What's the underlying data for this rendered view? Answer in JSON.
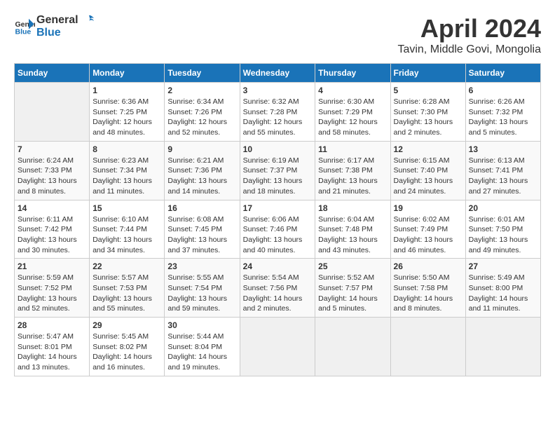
{
  "header": {
    "logo_general": "General",
    "logo_blue": "Blue",
    "month": "April 2024",
    "location": "Tavin, Middle Govi, Mongolia"
  },
  "weekdays": [
    "Sunday",
    "Monday",
    "Tuesday",
    "Wednesday",
    "Thursday",
    "Friday",
    "Saturday"
  ],
  "weeks": [
    [
      {
        "day": "",
        "sunrise": "",
        "sunset": "",
        "daylight": ""
      },
      {
        "day": "1",
        "sunrise": "Sunrise: 6:36 AM",
        "sunset": "Sunset: 7:25 PM",
        "daylight": "Daylight: 12 hours and 48 minutes."
      },
      {
        "day": "2",
        "sunrise": "Sunrise: 6:34 AM",
        "sunset": "Sunset: 7:26 PM",
        "daylight": "Daylight: 12 hours and 52 minutes."
      },
      {
        "day": "3",
        "sunrise": "Sunrise: 6:32 AM",
        "sunset": "Sunset: 7:28 PM",
        "daylight": "Daylight: 12 hours and 55 minutes."
      },
      {
        "day": "4",
        "sunrise": "Sunrise: 6:30 AM",
        "sunset": "Sunset: 7:29 PM",
        "daylight": "Daylight: 12 hours and 58 minutes."
      },
      {
        "day": "5",
        "sunrise": "Sunrise: 6:28 AM",
        "sunset": "Sunset: 7:30 PM",
        "daylight": "Daylight: 13 hours and 2 minutes."
      },
      {
        "day": "6",
        "sunrise": "Sunrise: 6:26 AM",
        "sunset": "Sunset: 7:32 PM",
        "daylight": "Daylight: 13 hours and 5 minutes."
      }
    ],
    [
      {
        "day": "7",
        "sunrise": "Sunrise: 6:24 AM",
        "sunset": "Sunset: 7:33 PM",
        "daylight": "Daylight: 13 hours and 8 minutes."
      },
      {
        "day": "8",
        "sunrise": "Sunrise: 6:23 AM",
        "sunset": "Sunset: 7:34 PM",
        "daylight": "Daylight: 13 hours and 11 minutes."
      },
      {
        "day": "9",
        "sunrise": "Sunrise: 6:21 AM",
        "sunset": "Sunset: 7:36 PM",
        "daylight": "Daylight: 13 hours and 14 minutes."
      },
      {
        "day": "10",
        "sunrise": "Sunrise: 6:19 AM",
        "sunset": "Sunset: 7:37 PM",
        "daylight": "Daylight: 13 hours and 18 minutes."
      },
      {
        "day": "11",
        "sunrise": "Sunrise: 6:17 AM",
        "sunset": "Sunset: 7:38 PM",
        "daylight": "Daylight: 13 hours and 21 minutes."
      },
      {
        "day": "12",
        "sunrise": "Sunrise: 6:15 AM",
        "sunset": "Sunset: 7:40 PM",
        "daylight": "Daylight: 13 hours and 24 minutes."
      },
      {
        "day": "13",
        "sunrise": "Sunrise: 6:13 AM",
        "sunset": "Sunset: 7:41 PM",
        "daylight": "Daylight: 13 hours and 27 minutes."
      }
    ],
    [
      {
        "day": "14",
        "sunrise": "Sunrise: 6:11 AM",
        "sunset": "Sunset: 7:42 PM",
        "daylight": "Daylight: 13 hours and 30 minutes."
      },
      {
        "day": "15",
        "sunrise": "Sunrise: 6:10 AM",
        "sunset": "Sunset: 7:44 PM",
        "daylight": "Daylight: 13 hours and 34 minutes."
      },
      {
        "day": "16",
        "sunrise": "Sunrise: 6:08 AM",
        "sunset": "Sunset: 7:45 PM",
        "daylight": "Daylight: 13 hours and 37 minutes."
      },
      {
        "day": "17",
        "sunrise": "Sunrise: 6:06 AM",
        "sunset": "Sunset: 7:46 PM",
        "daylight": "Daylight: 13 hours and 40 minutes."
      },
      {
        "day": "18",
        "sunrise": "Sunrise: 6:04 AM",
        "sunset": "Sunset: 7:48 PM",
        "daylight": "Daylight: 13 hours and 43 minutes."
      },
      {
        "day": "19",
        "sunrise": "Sunrise: 6:02 AM",
        "sunset": "Sunset: 7:49 PM",
        "daylight": "Daylight: 13 hours and 46 minutes."
      },
      {
        "day": "20",
        "sunrise": "Sunrise: 6:01 AM",
        "sunset": "Sunset: 7:50 PM",
        "daylight": "Daylight: 13 hours and 49 minutes."
      }
    ],
    [
      {
        "day": "21",
        "sunrise": "Sunrise: 5:59 AM",
        "sunset": "Sunset: 7:52 PM",
        "daylight": "Daylight: 13 hours and 52 minutes."
      },
      {
        "day": "22",
        "sunrise": "Sunrise: 5:57 AM",
        "sunset": "Sunset: 7:53 PM",
        "daylight": "Daylight: 13 hours and 55 minutes."
      },
      {
        "day": "23",
        "sunrise": "Sunrise: 5:55 AM",
        "sunset": "Sunset: 7:54 PM",
        "daylight": "Daylight: 13 hours and 59 minutes."
      },
      {
        "day": "24",
        "sunrise": "Sunrise: 5:54 AM",
        "sunset": "Sunset: 7:56 PM",
        "daylight": "Daylight: 14 hours and 2 minutes."
      },
      {
        "day": "25",
        "sunrise": "Sunrise: 5:52 AM",
        "sunset": "Sunset: 7:57 PM",
        "daylight": "Daylight: 14 hours and 5 minutes."
      },
      {
        "day": "26",
        "sunrise": "Sunrise: 5:50 AM",
        "sunset": "Sunset: 7:58 PM",
        "daylight": "Daylight: 14 hours and 8 minutes."
      },
      {
        "day": "27",
        "sunrise": "Sunrise: 5:49 AM",
        "sunset": "Sunset: 8:00 PM",
        "daylight": "Daylight: 14 hours and 11 minutes."
      }
    ],
    [
      {
        "day": "28",
        "sunrise": "Sunrise: 5:47 AM",
        "sunset": "Sunset: 8:01 PM",
        "daylight": "Daylight: 14 hours and 13 minutes."
      },
      {
        "day": "29",
        "sunrise": "Sunrise: 5:45 AM",
        "sunset": "Sunset: 8:02 PM",
        "daylight": "Daylight: 14 hours and 16 minutes."
      },
      {
        "day": "30",
        "sunrise": "Sunrise: 5:44 AM",
        "sunset": "Sunset: 8:04 PM",
        "daylight": "Daylight: 14 hours and 19 minutes."
      },
      {
        "day": "",
        "sunrise": "",
        "sunset": "",
        "daylight": ""
      },
      {
        "day": "",
        "sunrise": "",
        "sunset": "",
        "daylight": ""
      },
      {
        "day": "",
        "sunrise": "",
        "sunset": "",
        "daylight": ""
      },
      {
        "day": "",
        "sunrise": "",
        "sunset": "",
        "daylight": ""
      }
    ]
  ]
}
